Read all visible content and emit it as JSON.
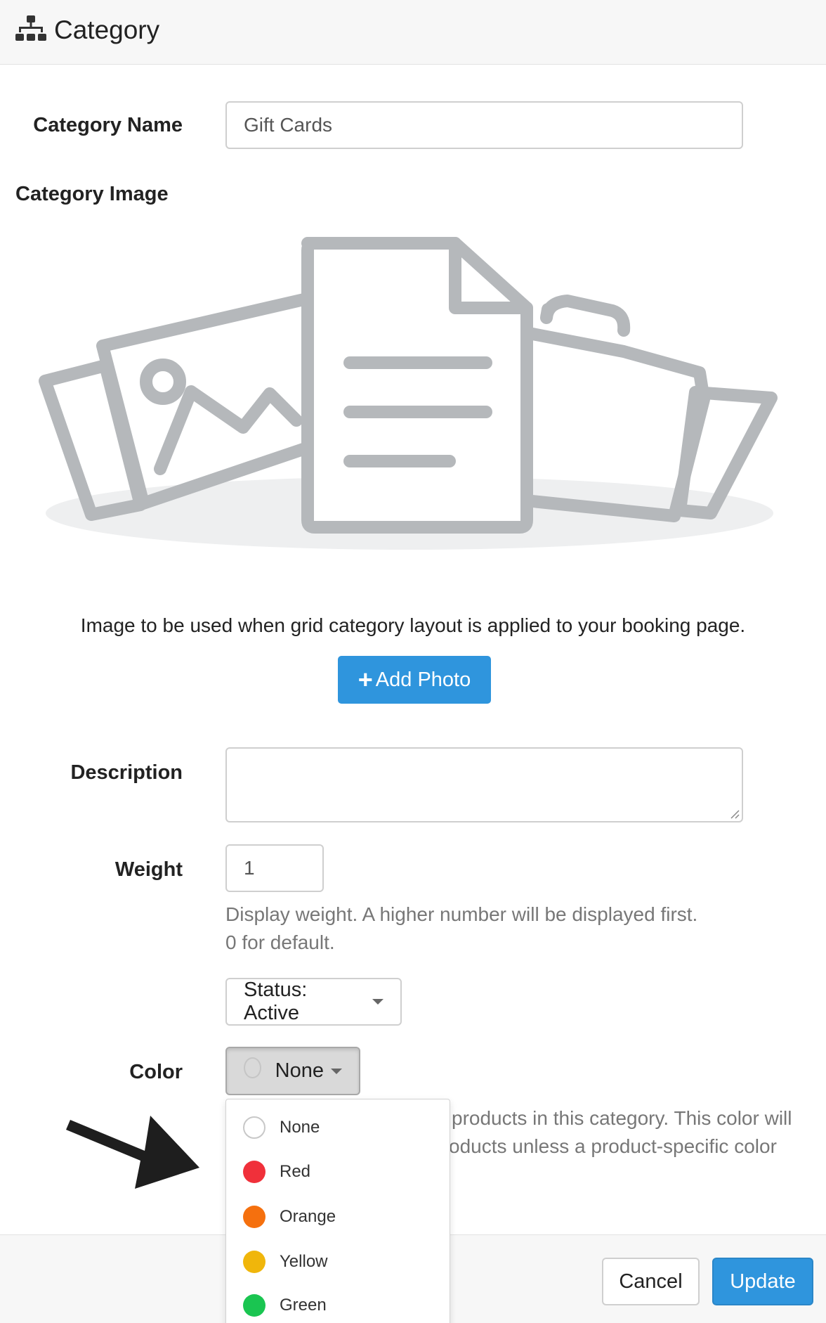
{
  "header": {
    "title": "Category",
    "icon": "sitemap-icon"
  },
  "form": {
    "category_name_label": "Category Name",
    "category_name_value": "Gift Cards",
    "category_image_label": "Category Image",
    "image_help": "Image to be used when grid category layout is applied to your booking page.",
    "add_photo_label": "Add Photo",
    "description_label": "Description",
    "description_value": "",
    "weight_label": "Weight",
    "weight_value": "1",
    "weight_help_line1": "Display weight. A higher number will be displayed first.",
    "weight_help_line2": "0 for default.",
    "status_label": "Status: Active",
    "color_label": "Color",
    "color_selected": "None",
    "color_help_line1": "products in this category. This color will",
    "color_help_line2": "oducts unless a product-specific color"
  },
  "color_menu": [
    {
      "label": "None",
      "color": "#ffffff"
    },
    {
      "label": "Red",
      "color": "#f0303a"
    },
    {
      "label": "Orange",
      "color": "#f5700e"
    },
    {
      "label": "Yellow",
      "color": "#f0b60b"
    },
    {
      "label": "Green",
      "color": "#1ac551"
    }
  ],
  "footer": {
    "cancel_label": "Cancel",
    "update_label": "Update"
  },
  "colors": {
    "accent": "#2f95dd",
    "illustration_gray": "#b5b8bb"
  }
}
